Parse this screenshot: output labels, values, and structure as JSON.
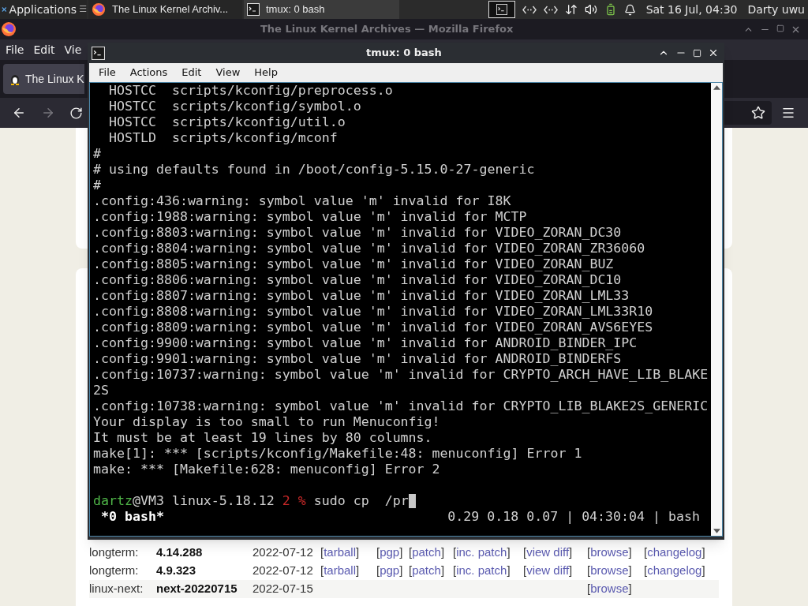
{
  "top_panel": {
    "applications": "Applications",
    "menu_glyph": "☰",
    "tasks": [
      {
        "title": "The Linux Kernel Archiv...",
        "kind": "browser",
        "selected": false
      },
      {
        "title": "tmux: 0 bash",
        "kind": "terminal",
        "selected": true
      }
    ],
    "clock": "Sat 16 Jul, 04:30",
    "user": "Darty uwu"
  },
  "firefox": {
    "title": "The Linux Kernel Archives — Mozilla Firefox",
    "menu": [
      "File",
      "Edit",
      "Vie"
    ],
    "tab": "The Linux K",
    "releases": [
      {
        "kind": "longterm:",
        "version": "4.14.288",
        "date": "2022-07-12",
        "links": [
          {
            "kind": "tarball",
            "label": "[tarball]"
          },
          {
            "kind": "pgp",
            "label": "[pgp]"
          },
          {
            "kind": "patch",
            "label": "[patch]"
          },
          {
            "kind": "incremental",
            "label": "[inc. patch]"
          },
          {
            "kind": "diff",
            "label": "[view diff]"
          },
          {
            "kind": "browse",
            "label": "[browse]"
          },
          {
            "kind": "changelog",
            "label": "[changelog]"
          }
        ],
        "shaded": false
      },
      {
        "kind": "longterm:",
        "version": "4.9.323",
        "date": "2022-07-12",
        "links": [
          {
            "kind": "tarball",
            "label": "[tarball]"
          },
          {
            "kind": "pgp",
            "label": "[pgp]"
          },
          {
            "kind": "patch",
            "label": "[patch]"
          },
          {
            "kind": "incremental",
            "label": "[inc. patch]"
          },
          {
            "kind": "diff",
            "label": "[view diff]"
          },
          {
            "kind": "browse",
            "label": "[browse]"
          },
          {
            "kind": "changelog",
            "label": "[changelog]"
          }
        ],
        "shaded": false
      },
      {
        "kind": "linux-next:",
        "version": "next-20220715",
        "date": "2022-07-15",
        "links": [
          {
            "kind": "browse",
            "label": "[browse]"
          }
        ],
        "shaded": true
      }
    ]
  },
  "terminal": {
    "title": "tmux: 0 bash",
    "menu": [
      "File",
      "Actions",
      "Edit",
      "View",
      "Help"
    ],
    "lines": [
      "  HOSTCC  scripts/kconfig/preprocess.o",
      "  HOSTCC  scripts/kconfig/symbol.o",
      "  HOSTCC  scripts/kconfig/util.o",
      "  HOSTLD  scripts/kconfig/mconf",
      "#",
      "# using defaults found in /boot/config-5.15.0-27-generic",
      "#",
      ".config:436:warning: symbol value 'm' invalid for I8K",
      ".config:1988:warning: symbol value 'm' invalid for MCTP",
      ".config:8803:warning: symbol value 'm' invalid for VIDEO_ZORAN_DC30",
      ".config:8804:warning: symbol value 'm' invalid for VIDEO_ZORAN_ZR36060",
      ".config:8805:warning: symbol value 'm' invalid for VIDEO_ZORAN_BUZ",
      ".config:8806:warning: symbol value 'm' invalid for VIDEO_ZORAN_DC10",
      ".config:8807:warning: symbol value 'm' invalid for VIDEO_ZORAN_LML33",
      ".config:8808:warning: symbol value 'm' invalid for VIDEO_ZORAN_LML33R10",
      ".config:8809:warning: symbol value 'm' invalid for VIDEO_ZORAN_AVS6EYES",
      ".config:9900:warning: symbol value 'm' invalid for ANDROID_BINDER_IPC",
      ".config:9901:warning: symbol value 'm' invalid for ANDROID_BINDERFS",
      ".config:10737:warning: symbol value 'm' invalid for CRYPTO_ARCH_HAVE_LIB_BLAKE",
      "2S",
      ".config:10738:warning: symbol value 'm' invalid for CRYPTO_LIB_BLAKE2S_GENERIC",
      "Your display is too small to run Menuconfig!",
      "It must be at least 19 lines by 80 columns.",
      "make[1]: *** [scripts/kconfig/Makefile:48: menuconfig] Error 1",
      "make: *** [Makefile:628: menuconfig] Error 2"
    ],
    "prompt": {
      "user": "dartz",
      "host_path": "@VM3 linux-5.18.12",
      "exit_code": "2",
      "symbol": "%",
      "command": "sudo cp  /pr"
    },
    "status": {
      "session": "*0 bash*",
      "info": "0.29 0.18 0.07 | 04:30:04 | bash"
    }
  }
}
